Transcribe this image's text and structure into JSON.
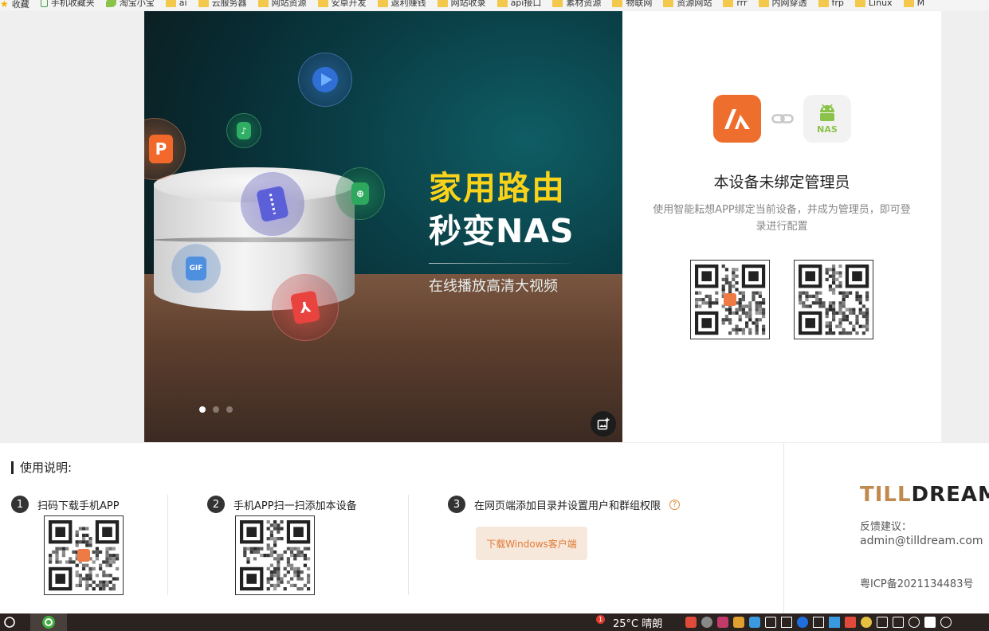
{
  "bookmarks": [
    {
      "label": "收藏",
      "icon": "star-icon"
    },
    {
      "label": "手机收藏夹",
      "icon": "phone-icon"
    },
    {
      "label": "淘宝小宝",
      "icon": "leaf-icon"
    },
    {
      "label": "ai",
      "icon": "folder-icon"
    },
    {
      "label": "云服务器",
      "icon": "folder-icon"
    },
    {
      "label": "网站资源",
      "icon": "folder-icon"
    },
    {
      "label": "安卓开发",
      "icon": "folder-icon"
    },
    {
      "label": "返利赚钱",
      "icon": "folder-icon"
    },
    {
      "label": "网站收录",
      "icon": "folder-icon"
    },
    {
      "label": "api接口",
      "icon": "folder-icon"
    },
    {
      "label": "素材资源",
      "icon": "folder-icon"
    },
    {
      "label": "物联网",
      "icon": "folder-icon"
    },
    {
      "label": "资源网站",
      "icon": "folder-icon"
    },
    {
      "label": "rrr",
      "icon": "folder-icon"
    },
    {
      "label": "内网穿透",
      "icon": "folder-icon"
    },
    {
      "label": "frp",
      "icon": "folder-icon"
    },
    {
      "label": "Linux",
      "icon": "folder-icon"
    },
    {
      "label": "M",
      "icon": "folder-icon"
    }
  ],
  "hero": {
    "title_line1": "家用路由",
    "title_line2": "秒变NAS",
    "subtitle": "在线播放高清大视频",
    "slides_total": 3,
    "slide_active": 1,
    "accent_color": "#f9d21a"
  },
  "bind_panel": {
    "title": "本设备未绑定管理员",
    "description": "使用智能耘想APP绑定当前设备，并成为管理员，即可登录进行配置",
    "app_logo_color": "#ee6f2d",
    "nas_label": "NAS"
  },
  "instructions": {
    "heading": "使用说明:",
    "steps": [
      {
        "number": "1",
        "label": "扫码下载手机APP"
      },
      {
        "number": "2",
        "label": "手机APP扫一扫添加本设备"
      },
      {
        "number": "3",
        "label": "在网页端添加目录并设置用户和群组权限"
      }
    ],
    "download_button": "下载Windows客户端"
  },
  "sidebar": {
    "brand_part1": "TILL",
    "brand_part2": "DREAM",
    "feedback_label": "反馈建议：",
    "feedback_email": "admin@tilldream.com",
    "icp": "粤ICP备2021134483号"
  },
  "taskbar": {
    "weather_badge": "1",
    "weather": "25°C  晴朗"
  }
}
